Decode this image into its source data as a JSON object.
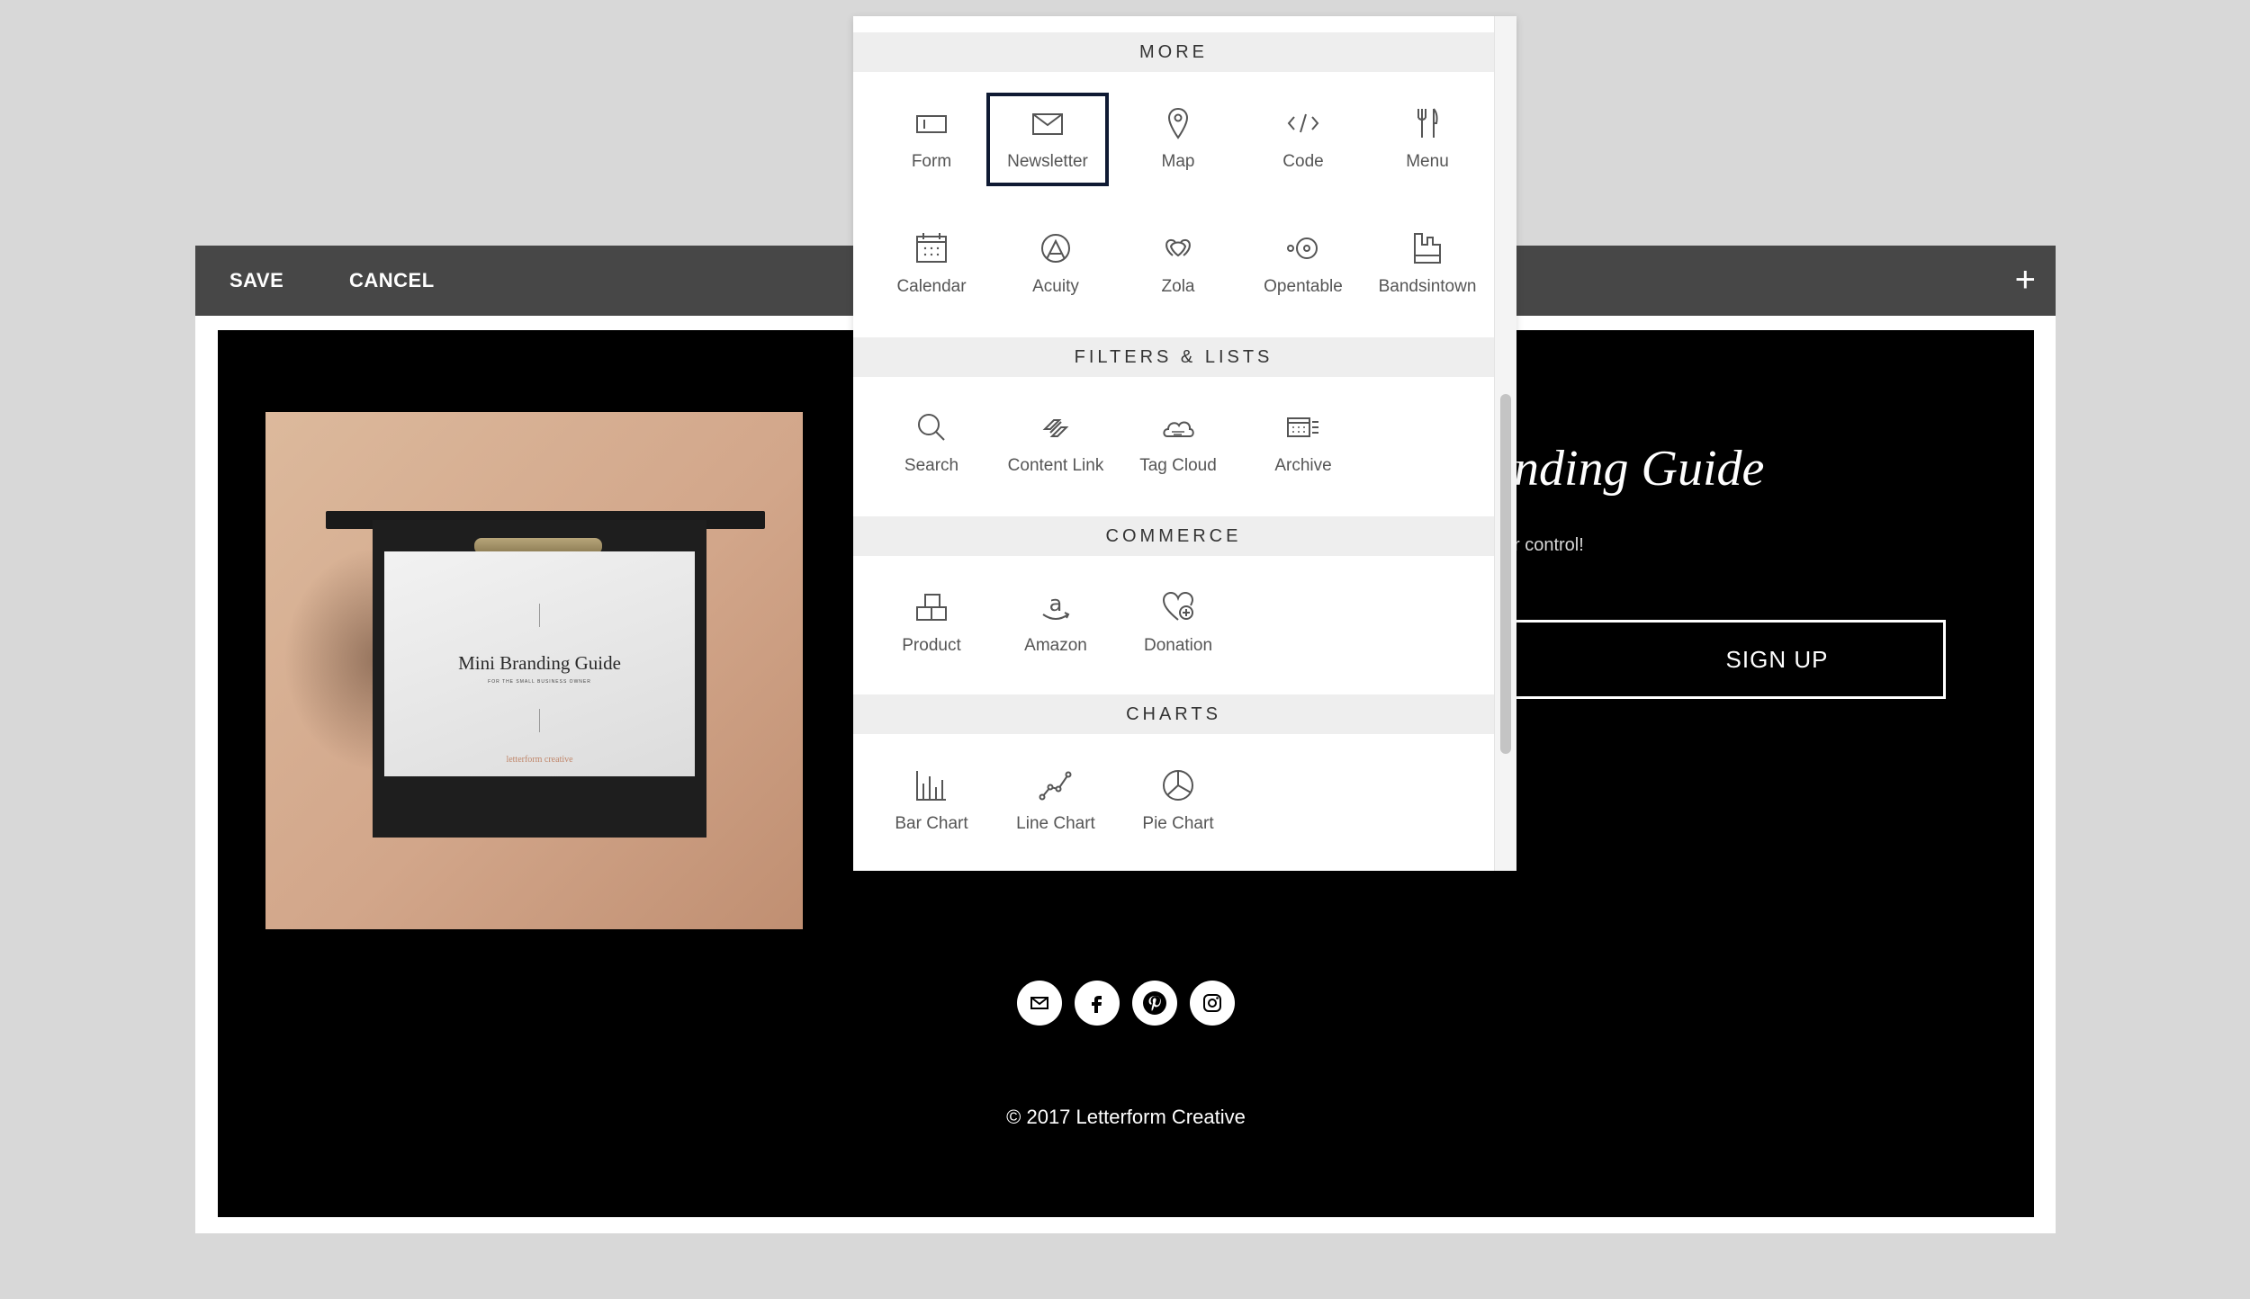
{
  "toolbar": {
    "save_label": "SAVE",
    "cancel_label": "CANCEL",
    "add_label": "+"
  },
  "content": {
    "product_image": {
      "title": "Mini Branding Guide",
      "subtitle": "FOR THE SMALL BUSINESS OWNER",
      "brand": "letterform creative"
    },
    "heading_partial": "nding Guide",
    "subtext_partial": "r control!",
    "signup_label": "SIGN UP",
    "social_icons": [
      "email-icon",
      "facebook-icon",
      "pinterest-icon",
      "instagram-icon"
    ],
    "copyright": "© 2017 Letterform Creative"
  },
  "picker": {
    "sections": [
      {
        "title": "MORE",
        "items": [
          {
            "label": "Form",
            "icon": "form-icon"
          },
          {
            "label": "Newsletter",
            "icon": "newsletter-icon",
            "selected": true
          },
          {
            "label": "Map",
            "icon": "map-icon"
          },
          {
            "label": "Code",
            "icon": "code-icon"
          },
          {
            "label": "Menu",
            "icon": "menu-icon"
          },
          {
            "label": "Calendar",
            "icon": "calendar-icon"
          },
          {
            "label": "Acuity",
            "icon": "acuity-icon"
          },
          {
            "label": "Zola",
            "icon": "zola-icon"
          },
          {
            "label": "Opentable",
            "icon": "opentable-icon"
          },
          {
            "label": "Bandsintown",
            "icon": "bandsintown-icon"
          }
        ]
      },
      {
        "title": "FILTERS & LISTS",
        "items": [
          {
            "label": "Search",
            "icon": "search-icon"
          },
          {
            "label": "Content Link",
            "icon": "content-link-icon"
          },
          {
            "label": "Tag Cloud",
            "icon": "tag-cloud-icon"
          },
          {
            "label": "Archive",
            "icon": "archive-icon"
          }
        ]
      },
      {
        "title": "COMMERCE",
        "items": [
          {
            "label": "Product",
            "icon": "product-icon"
          },
          {
            "label": "Amazon",
            "icon": "amazon-icon"
          },
          {
            "label": "Donation",
            "icon": "donation-icon"
          }
        ]
      },
      {
        "title": "CHARTS",
        "items": [
          {
            "label": "Bar Chart",
            "icon": "bar-chart-icon"
          },
          {
            "label": "Line Chart",
            "icon": "line-chart-icon"
          },
          {
            "label": "Pie Chart",
            "icon": "pie-chart-icon"
          }
        ]
      }
    ]
  },
  "colors": {
    "toolbar_bg": "#474747",
    "page_bg": "#d8d8d8",
    "selected_border": "#0f1a33"
  }
}
